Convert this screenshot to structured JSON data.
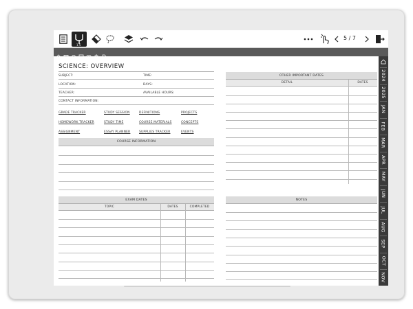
{
  "toolbar": {
    "icons": [
      "page-list-icon",
      "pen-icon",
      "eraser-icon",
      "lasso-icon",
      "layers-icon",
      "undo-icon",
      "redo-icon",
      "more-icon",
      "touch-icon",
      "prev-page-icon",
      "next-page-icon",
      "exit-icon"
    ],
    "pen_size": "1.5",
    "page_indicator": "5 / 7"
  },
  "strip": {
    "icons": [
      "home-icon",
      "calendar-icon",
      "settings-icon",
      "note-icon",
      "heart-icon",
      "trash-icon",
      "document-icon"
    ]
  },
  "tabs": {
    "top_icon": "home-icon",
    "items": [
      "2024",
      "2025",
      "JAN",
      "FEB",
      "MAR",
      "APR",
      "MAY",
      "JUN",
      "JUL",
      "AUG",
      "SEP",
      "OCT",
      "NOV"
    ]
  },
  "page": {
    "title": "SCIENCE: OVERVIEW",
    "fields": {
      "subject": "SUBJECT:",
      "time": "TIME:",
      "location": "LOCATION:",
      "days": "DAYS:",
      "teacher": "TEACHER:",
      "available_hours": "AVAILABLE HOURS:",
      "contact": "CONTACT INFORMATION:"
    },
    "links": [
      [
        "GRADE TRACKER",
        "STUDY SESSION",
        "DEFINITIONS",
        "PROJECTS"
      ],
      [
        "HOMEWORK TRACKER",
        "STUDY TIME",
        "COURSE MATERIALS",
        "CONCEPTS"
      ],
      [
        "ASSIGNMENT",
        "ESSAY PLANNER",
        "SUPPLIES TRACKER",
        "EVENTS"
      ]
    ],
    "course_information": "COURSE INFORMATION",
    "other_dates": {
      "title": "OTHER IMPORTANT DATES",
      "col_detail": "DETAIL",
      "col_dates": "DATES"
    },
    "exam_dates": {
      "title": "EXAM DATES",
      "col_topic": "TOPIC",
      "col_dates": "DATES",
      "col_completed": "COMPLETED"
    },
    "notes": "NOTES"
  }
}
